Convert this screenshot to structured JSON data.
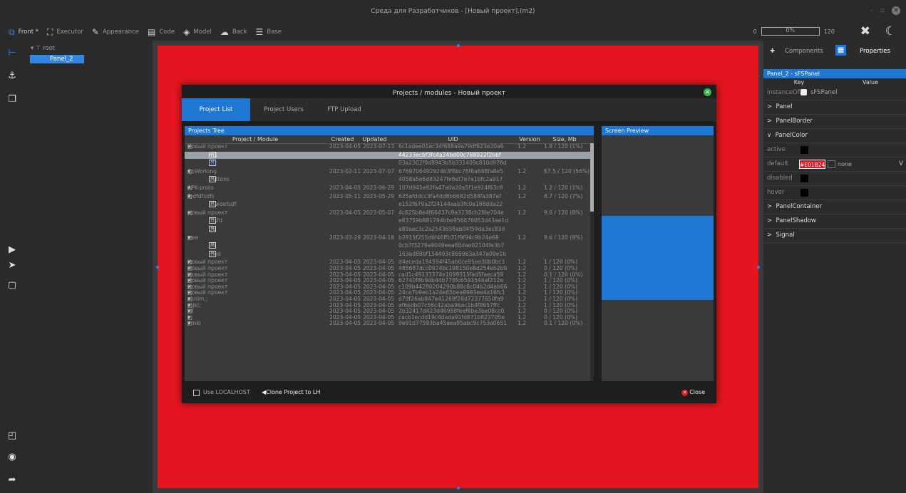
{
  "window": {
    "title": "Среда для Разработчиков - [Новый проект].(m2)"
  },
  "toolbar": {
    "items": [
      {
        "label": "Front *",
        "icon": "code-window-icon"
      },
      {
        "label": "Executor",
        "icon": "flowchart-icon"
      },
      {
        "label": "Appearance",
        "icon": "paint-icon"
      },
      {
        "label": "Code",
        "icon": "document-icon"
      },
      {
        "label": "Model",
        "icon": "layers-icon"
      },
      {
        "label": "Back",
        "icon": "cloud-icon"
      },
      {
        "label": "Base",
        "icon": "database-icon"
      }
    ],
    "zoom_min": "0",
    "zoom_value": "0%",
    "zoom_max": "120"
  },
  "tree": {
    "root_label": "root",
    "child_label": "Panel_2"
  },
  "dialog": {
    "title": "Projects / modules - Новый проект",
    "tabs": [
      "Project List",
      "Project Users",
      "FTP Upload"
    ],
    "projects_tree_header": "Projects Tree",
    "screen_preview_header": "Screen Preview",
    "columns": [
      "Project / Module",
      "Created",
      "Updated",
      "UID",
      "Version",
      "Size, Mb"
    ],
    "rows": [
      {
        "name": "Новый проект",
        "kind": "project",
        "created": "2023-04-05",
        "updated": "2023-07-13",
        "uid": "6c1adee01ec34f688a9a79df623e20a6",
        "version": "1.2",
        "size": "1.9 / 120 (1%)"
      },
      {
        "name": "m1",
        "kind": "module",
        "created": "",
        "updated": "",
        "uid": "44233ecbf3fc4a24bd00c788022f2bbf",
        "version": "",
        "size": ""
      },
      {
        "name": "m2",
        "kind": "module",
        "created": "",
        "updated": "",
        "uid": "03a2302f9d8943b5b331409c810d978d",
        "version": "",
        "size": ""
      },
      {
        "name": "CoWorking",
        "kind": "project",
        "created": "2023-02-11",
        "updated": "2023-07-07",
        "uid": "6769706492924b3f8bc78f6a688fa8e5",
        "version": "1.2",
        "size": "67.5 / 120 (56%)"
      },
      {
        "name": "buttons",
        "kind": "module",
        "created": "",
        "updated": "",
        "uid": "4058a5e6d93247fe8ef7e7a1bfc2a917",
        "version": "",
        "size": ""
      },
      {
        "name": "APK-proto",
        "kind": "project",
        "created": "2023-04-05",
        "updated": "2023-06-29",
        "uid": "107d945e82fa47a0a20a5f1e924f63c8",
        "version": "1.2",
        "size": "1.2 / 120 (1%)"
      },
      {
        "name": "fedfdfsdfs",
        "kind": "project",
        "created": "2023-05-11",
        "updated": "2023-05-29",
        "uid": "625afddcc3fa4dd8b6682d588fa387ef",
        "version": "1.2",
        "size": "8.7 / 120 (7%)"
      },
      {
        "name": "aswdefsdf",
        "kind": "module",
        "created": "",
        "updated": "",
        "uid": "e152f679a2f24144aab3fc0a188dda22",
        "version": "",
        "size": ""
      },
      {
        "name": "Новый проект",
        "kind": "project",
        "created": "2023-04-05",
        "updated": "2023-05-07",
        "uid": "4c625b8e4f66437c8a3238cb2f0e704e",
        "version": "1.2",
        "size": "9.6 / 120 (8%)"
      },
      {
        "name": "fdsfd",
        "kind": "module",
        "created": "",
        "updated": "",
        "uid": "e83759b881794bbe956676053d43ae1d",
        "version": "",
        "size": ""
      },
      {
        "name": "ge",
        "kind": "module",
        "created": "",
        "updated": "",
        "uid": "a89aec3c2a2543658ab04f59da3ec83d",
        "version": "",
        "size": ""
      },
      {
        "name": "tree",
        "kind": "project",
        "created": "2023-03-29",
        "updated": "2023-04-18",
        "uid": "b2915f255d6f46ffb31f9f94c9b24e68",
        "version": "1.2",
        "size": "9.6 / 120 (8%)"
      },
      {
        "name": "ed",
        "kind": "module",
        "created": "",
        "updated": "",
        "uid": "0cb7f3279a9049eea80dae02104fe3b7",
        "version": "",
        "size": ""
      },
      {
        "name": "mod",
        "kind": "module",
        "created": "",
        "updated": "",
        "uid": "163ad89bf154493c869963a347a09e1b",
        "version": "",
        "size": ""
      },
      {
        "name": "Новый проект",
        "kind": "project",
        "created": "2023-04-05",
        "updated": "2023-04-05",
        "uid": "d4eceda194594f45ab0ce95ee30b0bc3",
        "version": "1.2",
        "size": "1 / 120 (0%)"
      },
      {
        "name": "Новый проект",
        "kind": "project",
        "created": "2023-04-05",
        "updated": "2023-04-05",
        "uid": "485687dcc0974bc198150e8d254eb2b9",
        "version": "1.2",
        "size": "0 / 120 (0%)"
      },
      {
        "name": "Новый проект",
        "kind": "project",
        "created": "2023-04-05",
        "updated": "2023-04-05",
        "uid": "cad1c49133374e1099315fad5faeca59",
        "version": "1.2",
        "size": "0.1 / 120 (0%)"
      },
      {
        "name": "Новый проект",
        "kind": "project",
        "created": "2023-04-05",
        "updated": "2023-04-05",
        "uid": "62740f8b9db44b778fc6593544af212e",
        "version": "1.2",
        "size": "1 / 120 (0%)"
      },
      {
        "name": "Новый проект",
        "kind": "project",
        "created": "2023-04-05",
        "updated": "2023-04-05",
        "uid": "c109b44280204290b88c8c04b2d4ab66",
        "version": "1.2",
        "size": "1 / 120 (0%)"
      },
      {
        "name": "Новый проект",
        "kind": "project",
        "created": "2023-04-05",
        "updated": "2023-04-05",
        "uid": "24ce7b9eb1a24e65bea8983ee4e16fc1",
        "version": "1.2",
        "size": "1 / 120 (0%)"
      },
      {
        "name": "nknlm,;",
        "kind": "project",
        "created": "2023-04-05",
        "updated": "2023-04-05",
        "uid": "d79f26ab847e41269f28d72377850fa9",
        "version": "1.2",
        "size": "1 / 120 (0%)"
      },
      {
        "name": "mjkl;",
        "kind": "project",
        "created": "2023-04-05",
        "updated": "2023-04-05",
        "uid": "ef6edb07c56c42aba96ac1b4f8657ffc",
        "version": "1.2",
        "size": "1 / 120 (0%)"
      },
      {
        "name": "jkl",
        "kind": "project",
        "created": "2023-04-05",
        "updated": "2023-04-05",
        "uid": "2b32417d423d46998feef6be3be08cc0",
        "version": "1.2",
        "size": "0 / 120 (0%)"
      },
      {
        "name": "l",
        "kind": "project",
        "created": "2023-04-05",
        "updated": "2023-04-05",
        "uid": "cacb1ecdd19c4dada91fd671b823705e",
        "version": "1.2",
        "size": "0 / 120 (0%)"
      },
      {
        "name": "nmkl",
        "kind": "project",
        "created": "2023-04-05",
        "updated": "2023-04-05",
        "uid": "9e91d77593ba45aea95abc9c753a0651",
        "version": "1.2",
        "size": "0.1 / 120 (0%)"
      }
    ],
    "selected_row": 1,
    "footer": {
      "use_localhost": "Use LOCALHOST",
      "clone": "Clone Project to LH",
      "close": "Close"
    }
  },
  "right": {
    "tabs": [
      "Components",
      "Properties"
    ],
    "panel_header": "Panel_2 - sFSPanel",
    "key_label": "Key",
    "value_label": "Value",
    "instance_key": "instanceOf",
    "instance_value": "sFSPanel",
    "groups": [
      "Panel",
      "PanelBorder",
      "PanelColor"
    ],
    "color_rows": [
      {
        "key": "active",
        "value": ""
      },
      {
        "key": "default",
        "value": "#E01B24",
        "extra": "none"
      },
      {
        "key": "disabled",
        "value": ""
      },
      {
        "key": "hover",
        "value": ""
      }
    ],
    "groups_after": [
      "PanelContainer",
      "PanelShadow",
      "Signal"
    ]
  },
  "colors": {
    "accent": "#1f77d4",
    "canvas_panel": "#E01B24"
  }
}
